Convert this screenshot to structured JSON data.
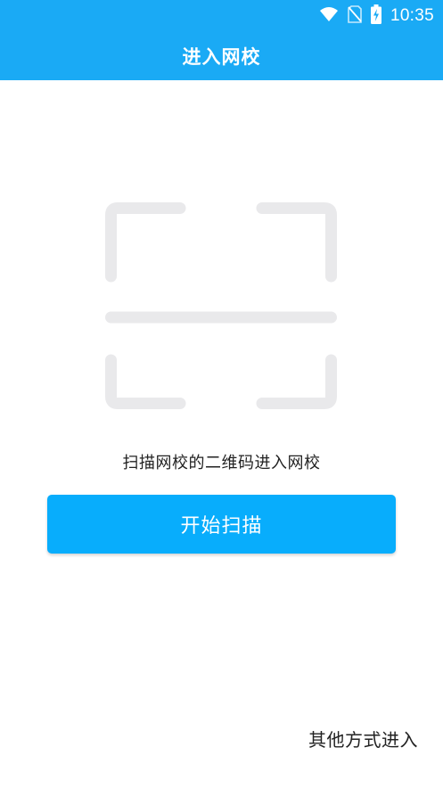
{
  "status_bar": {
    "time": "10:35",
    "icons": [
      "wifi-icon",
      "no-sim-icon",
      "battery-charging-icon"
    ]
  },
  "header": {
    "title": "进入网校"
  },
  "scan": {
    "hint": "扫描网校的二维码进入网校",
    "start_button_label": "开始扫描"
  },
  "footer": {
    "other_entry_label": "其他方式进入"
  },
  "colors": {
    "primary": "#1aaaf5",
    "button": "#08adfc",
    "frame": "#e9e9eb",
    "text": "#222222"
  }
}
